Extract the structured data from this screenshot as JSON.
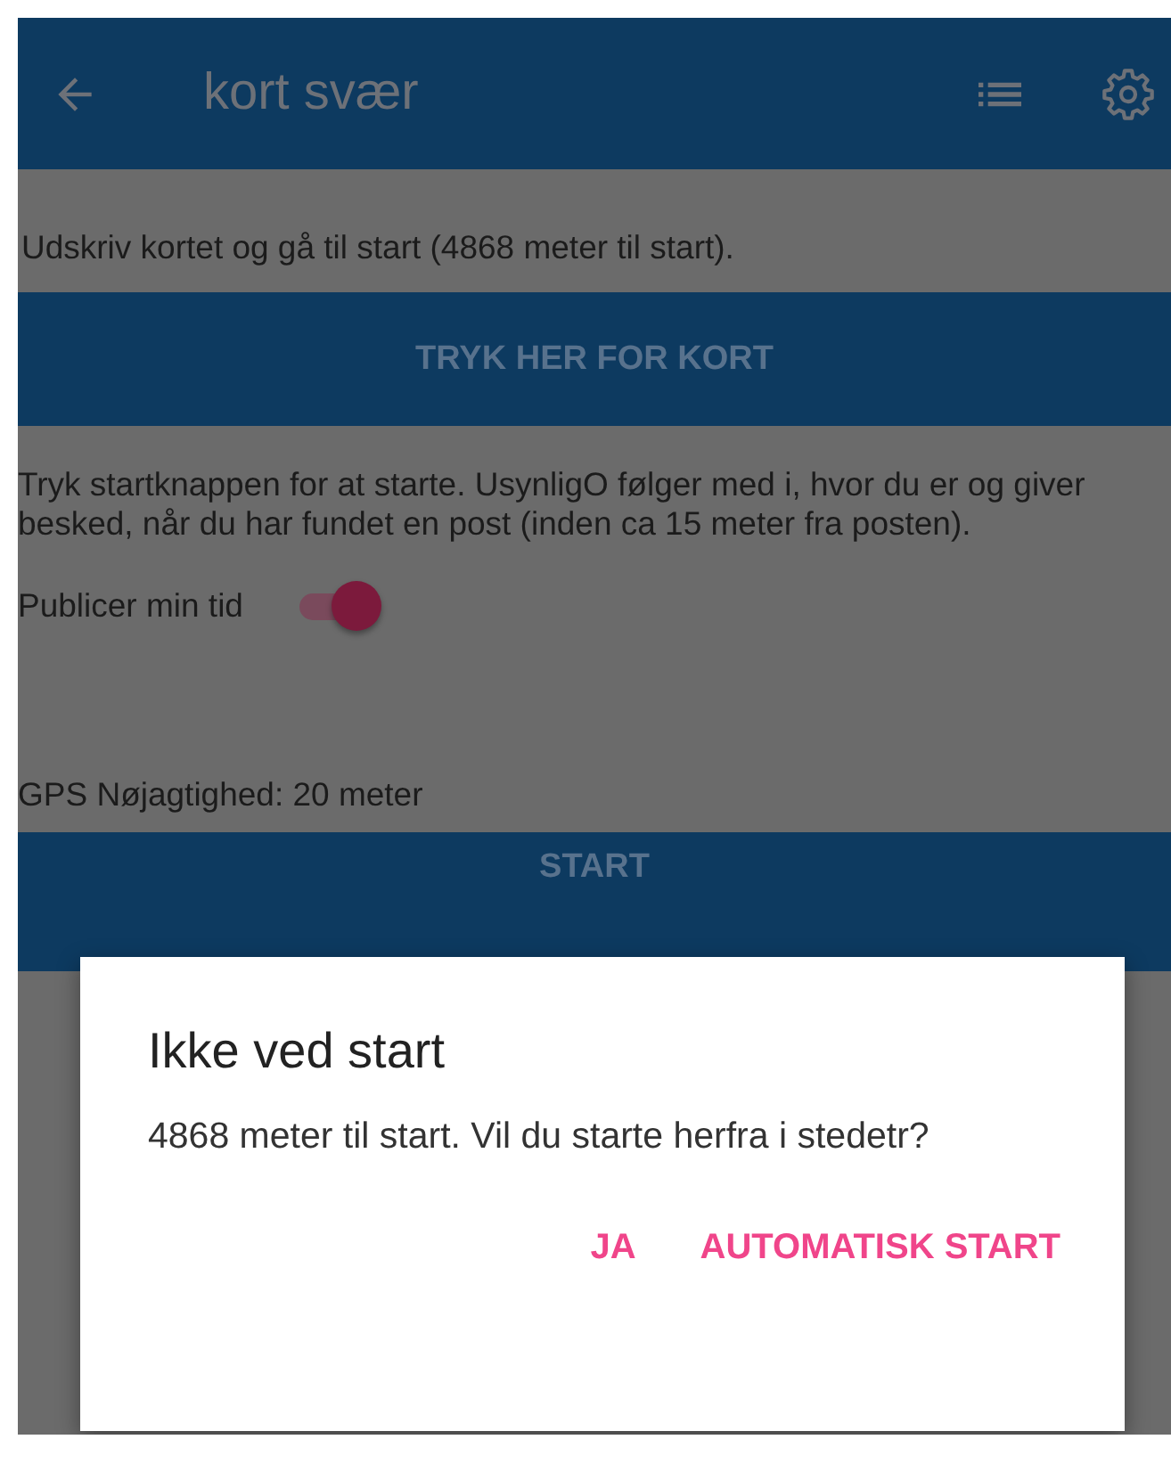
{
  "app_bar": {
    "title": "kort svær"
  },
  "intro": "Udskriv kortet og gå til start (4868 meter til start).",
  "map_button": "TRYK HER FOR KORT",
  "instructions": "Tryk startknappen for at starte. UsynligO følger med i, hvor du er og giver besked, når du har fundet en post (inden ca 15 meter fra posten).",
  "publish_toggle": {
    "label": "Publicer min tid",
    "on": true
  },
  "gps_accuracy": "GPS Nøjagtighed: 20 meter",
  "start_button": "START",
  "dialog": {
    "title": "Ikke ved start",
    "message": "4868 meter til start. Vil du starte herfra i stedetr?",
    "buttons": [
      "JA",
      "AUTOMATISK START"
    ]
  }
}
